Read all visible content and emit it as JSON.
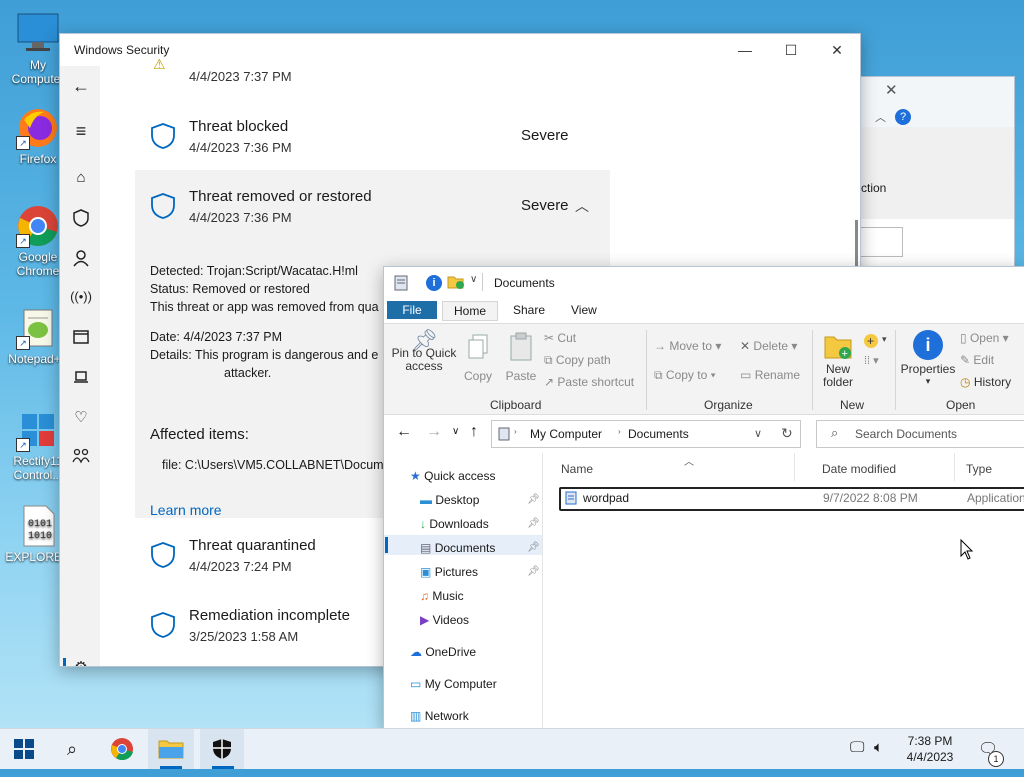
{
  "desktop": {
    "icons": [
      {
        "label": "My Computer"
      },
      {
        "label": "Firefox"
      },
      {
        "label": "Google Chrome"
      },
      {
        "label": "Notepad++"
      },
      {
        "label": "Rectify11 Control..."
      },
      {
        "label": "EXPLORER"
      }
    ]
  },
  "security": {
    "title": "Windows Security",
    "threats": [
      {
        "title": "",
        "date": "4/4/2023 7:37 PM",
        "severity": ""
      },
      {
        "title": "Threat blocked",
        "date": "4/4/2023 7:36 PM",
        "severity": "Severe"
      },
      {
        "title": "Threat removed or restored",
        "date": "4/4/2023 7:36 PM",
        "severity": "Severe"
      },
      {
        "title": "Threat quarantined",
        "date": "4/4/2023 7:24 PM",
        "severity": ""
      },
      {
        "title": "Remediation incomplete",
        "date": "3/25/2023 1:58 AM",
        "severity": ""
      }
    ],
    "details": {
      "detected_label": "Detected:",
      "detected": "Trojan:Script/Wacatac.H!ml",
      "status_label": "Status:",
      "status": "Removed or restored",
      "desc": "This threat or app was removed from qua",
      "date_label": "Date:",
      "date": "4/4/2023 7:37 PM",
      "details_label": "Details:",
      "details1": "This program is dangerous and e",
      "details2": "attacker.",
      "affected_heading": "Affected items:",
      "file": "file: C:\\Users\\VM5.COLLABNET\\Docum",
      "learn_more": "Learn more"
    }
  },
  "bg_dialog": {
    "text": "ction"
  },
  "explorer": {
    "title": "Documents",
    "tabs": [
      "File",
      "Home",
      "Share",
      "View"
    ],
    "ribbon": {
      "pin": "Pin to Quick access",
      "copy": "Copy",
      "paste": "Paste",
      "cut": "Cut",
      "copy_path": "Copy path",
      "paste_shortcut": "Paste shortcut",
      "clipboard": "Clipboard",
      "move_to": "Move to",
      "copy_to": "Copy to",
      "delete": "Delete",
      "rename": "Rename",
      "organize": "Organize",
      "new_folder": "New folder",
      "new": "New",
      "properties": "Properties",
      "open": "Open",
      "edit": "Edit",
      "history": "History",
      "open_group": "Open"
    },
    "path": [
      "My Computer",
      "Documents"
    ],
    "search_placeholder": "Search Documents",
    "nav": {
      "quick_access": "Quick access",
      "items": [
        "Desktop",
        "Downloads",
        "Documents",
        "Pictures",
        "Music",
        "Videos"
      ],
      "onedrive": "OneDrive",
      "my_computer": "My Computer",
      "network": "Network"
    },
    "columns": [
      "Name",
      "Date modified",
      "Type"
    ],
    "files": [
      {
        "name": "wordpad",
        "date": "9/7/2022 8:08 PM",
        "type": "Application"
      }
    ]
  },
  "taskbar": {
    "time": "7:38 PM",
    "date": "4/4/2023",
    "notif_count": "1"
  }
}
